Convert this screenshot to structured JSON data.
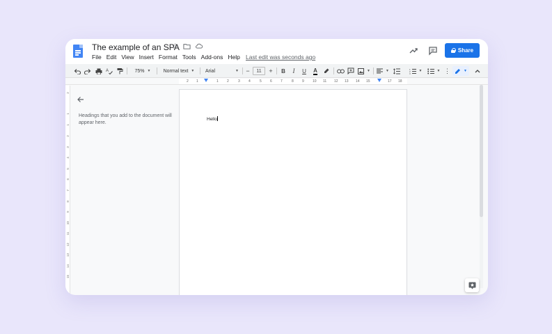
{
  "app": {
    "title": "The example of an SPA",
    "menu": [
      "File",
      "Edit",
      "View",
      "Insert",
      "Format",
      "Tools",
      "Add-ons",
      "Help"
    ],
    "last_edit": "Last edit was seconds ago",
    "share_label": "Share"
  },
  "toolbar": {
    "zoom": "75%",
    "style": "Normal text",
    "font": "Arial",
    "font_size": "11",
    "bold": "B",
    "italic": "I",
    "underline": "U",
    "text_color": "A",
    "minus": "−",
    "plus": "+"
  },
  "ruler": {
    "numbers": [
      "2",
      "1",
      "1",
      "2",
      "3",
      "4",
      "5",
      "6",
      "7",
      "8",
      "9",
      "10",
      "11",
      "12",
      "13",
      "14",
      "15",
      "17",
      "18"
    ]
  },
  "vruler": {
    "numbers": [
      "2",
      "1",
      "1",
      "2",
      "3",
      "4",
      "5",
      "6",
      "7",
      "8",
      "9",
      "10",
      "11",
      "12",
      "13",
      "14",
      "15"
    ]
  },
  "outline": {
    "empty_text": "Headings that you add to the document will appear here."
  },
  "document": {
    "body_text": "Hello"
  },
  "colors": {
    "background": "#e9e6fb",
    "accent": "#1a73e8",
    "docs_blue": "#4285f4"
  }
}
